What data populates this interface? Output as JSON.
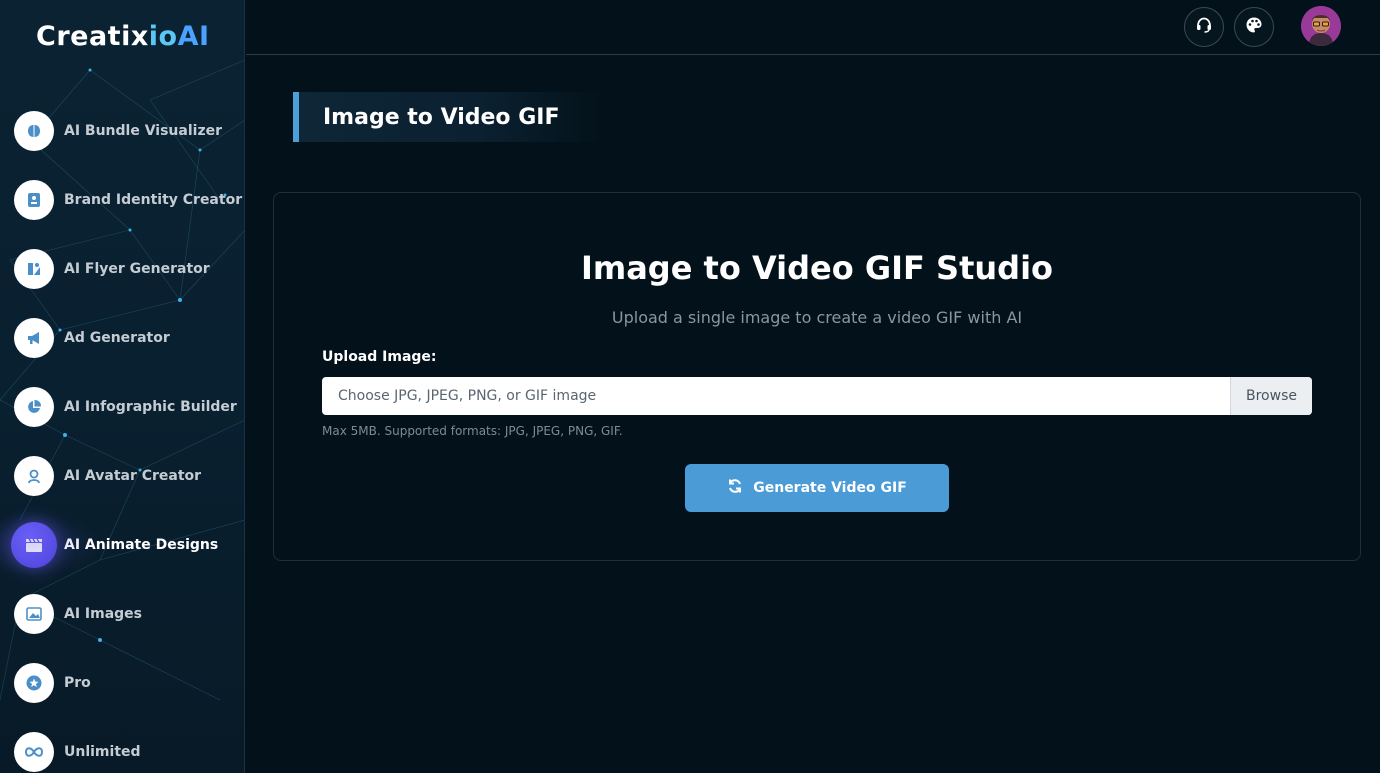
{
  "brand": {
    "part1": "Creatix",
    "part2": "io",
    "part3": "AI"
  },
  "sidebar": {
    "items": [
      {
        "label": "AI Bundle Visualizer",
        "icon": "brain-icon"
      },
      {
        "label": "Brand Identity Creator",
        "icon": "id-card-icon"
      },
      {
        "label": "AI Flyer Generator",
        "icon": "flyer-icon"
      },
      {
        "label": "Ad Generator",
        "icon": "megaphone-icon"
      },
      {
        "label": "AI Infographic Builder",
        "icon": "pie-chart-icon"
      },
      {
        "label": "AI Avatar Creator",
        "icon": "user-badge-icon"
      },
      {
        "label": "AI Animate Designs",
        "icon": "clapperboard-icon",
        "active": true
      },
      {
        "label": "AI Images",
        "icon": "image-icon"
      },
      {
        "label": "Pro",
        "icon": "star-icon"
      },
      {
        "label": "Unlimited",
        "icon": "infinity-icon"
      }
    ]
  },
  "topbar": {
    "support_icon": "headset-icon",
    "theme_icon": "palette-icon",
    "avatar": "user-avatar"
  },
  "page": {
    "title": "Image to Video GIF"
  },
  "studio": {
    "title": "Image to Video GIF Studio",
    "subtitle": "Upload a single image to create a video GIF with AI",
    "upload_label": "Upload Image:",
    "file_placeholder": "Choose JPG, JPEG, PNG, or GIF image",
    "browse_label": "Browse",
    "hint": "Max 5MB. Supported formats: JPG, JPEG, PNG, GIF.",
    "generate_label": "Generate Video GIF"
  },
  "colors": {
    "accent": "#4b9bd6",
    "active_nav": "#5b50e8",
    "background": "#03121a"
  }
}
